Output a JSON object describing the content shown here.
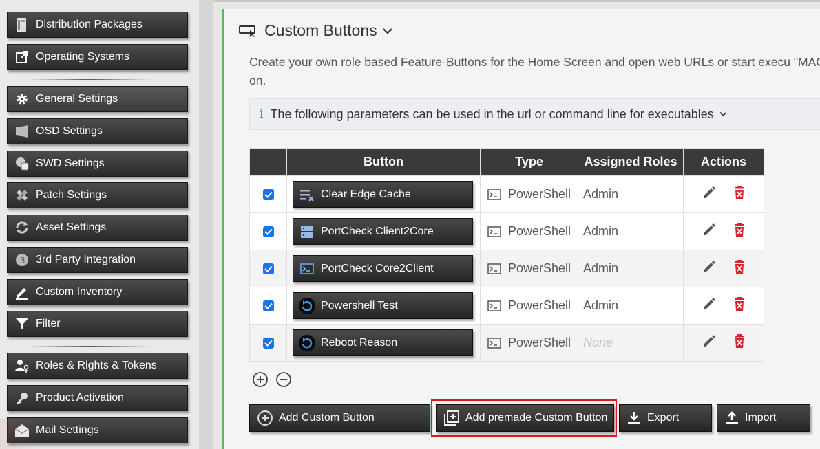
{
  "sidebar": {
    "items": [
      {
        "label": "Distribution Packages",
        "icon": "package-icon"
      },
      {
        "label": "Operating Systems",
        "icon": "external-link-icon"
      },
      {
        "label": "General Settings",
        "icon": "gear-icon"
      },
      {
        "label": "OSD Settings",
        "icon": "windows-icon"
      },
      {
        "label": "SWD Settings",
        "icon": "software-icon"
      },
      {
        "label": "Patch Settings",
        "icon": "patch-icon"
      },
      {
        "label": "Asset Settings",
        "icon": "refresh-icon"
      },
      {
        "label": "3rd Party Integration",
        "icon": "integration-icon"
      },
      {
        "label": "Custom Inventory",
        "icon": "pencil-icon"
      },
      {
        "label": "Filter",
        "icon": "filter-icon"
      },
      {
        "label": "Roles & Rights & Tokens",
        "icon": "user-key-icon"
      },
      {
        "label": "Product Activation",
        "icon": "key-icon"
      },
      {
        "label": "Mail Settings",
        "icon": "mail-icon"
      }
    ]
  },
  "panel": {
    "title": "Custom Buttons",
    "description": "Create your own role based Feature-Buttons for the Home Screen and open web URLs or start execu \"MAC\" and so on.",
    "info_icon": "i",
    "info_text": "The following parameters can be used in the url or command line for executables"
  },
  "table": {
    "headers": [
      "",
      "Button",
      "Type",
      "Assigned Roles",
      "Actions"
    ],
    "rows": [
      {
        "label": "Clear Edge Cache",
        "icon": "clear-list-icon",
        "type": "PowerShell",
        "role": "Admin",
        "role_empty": false
      },
      {
        "label": "PortCheck Client2Core",
        "icon": "server-icon",
        "type": "PowerShell",
        "role": "Admin",
        "role_empty": false
      },
      {
        "label": "PortCheck Core2Client",
        "icon": "terminal-icon",
        "type": "PowerShell",
        "role": "Admin",
        "role_empty": false
      },
      {
        "label": "Powershell Test",
        "icon": "reload-icon",
        "type": "PowerShell",
        "role": "Admin",
        "role_empty": false
      },
      {
        "label": "Reboot Reason",
        "icon": "reload-icon",
        "type": "PowerShell",
        "role": "None",
        "role_empty": true
      }
    ]
  },
  "actions": {
    "add_custom": "Add Custom Button",
    "add_premade": "Add premade Custom Button",
    "export": "Export",
    "import": "Import"
  },
  "colors": {
    "accent_green": "#5cb85c",
    "highlight_red": "#e0191e",
    "checkbox_blue": "#1a73e8",
    "delete_red": "#d9262c",
    "header_dark": "#3a3a3a"
  }
}
